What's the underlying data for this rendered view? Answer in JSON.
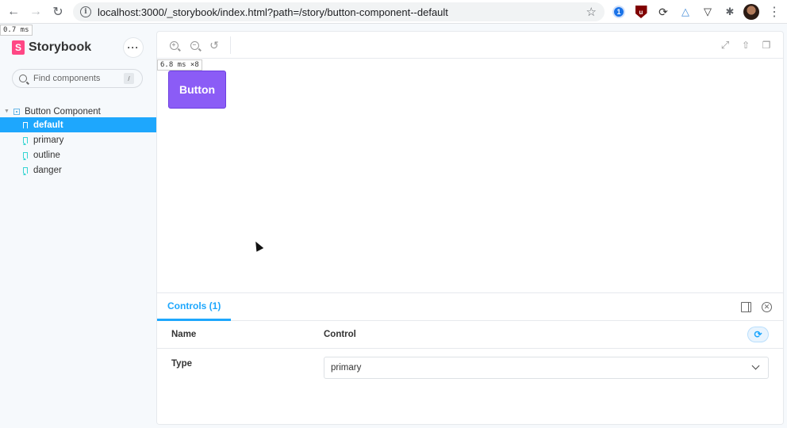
{
  "browser": {
    "url_host": "localhost:3000",
    "url_path": "/_storybook/index.html?path=/story/button-component--default",
    "info_glyph": "i",
    "extensions": [
      "1password-icon",
      "ublock-icon",
      "sync-icon",
      "drive-icon",
      "pocket-icon",
      "puzzle-icon",
      "avatar",
      "kebab-icon"
    ]
  },
  "timing": {
    "sidebar": "0.7 ms",
    "preview": "6.8 ms ×8"
  },
  "sidebar": {
    "brand": "Storybook",
    "brand_logo_letter": "S",
    "menu_label": "···",
    "search_placeholder": "Find components",
    "search_shortcut": "/",
    "group": {
      "label": "Button Component",
      "expanded": true
    },
    "stories": [
      {
        "label": "default",
        "selected": true
      },
      {
        "label": "primary",
        "selected": false
      },
      {
        "label": "outline",
        "selected": false
      },
      {
        "label": "danger",
        "selected": false
      }
    ]
  },
  "preview": {
    "demo_button_label": "Button",
    "demo_button_color": "#8b5cf6"
  },
  "addons": {
    "tab_label": "Controls (1)",
    "columns": {
      "name": "Name",
      "control": "Control"
    },
    "rows": [
      {
        "name": "Type",
        "value": "primary"
      }
    ]
  },
  "colors": {
    "accent": "#1ea7fd",
    "storybook_pink": "#ff4785"
  }
}
